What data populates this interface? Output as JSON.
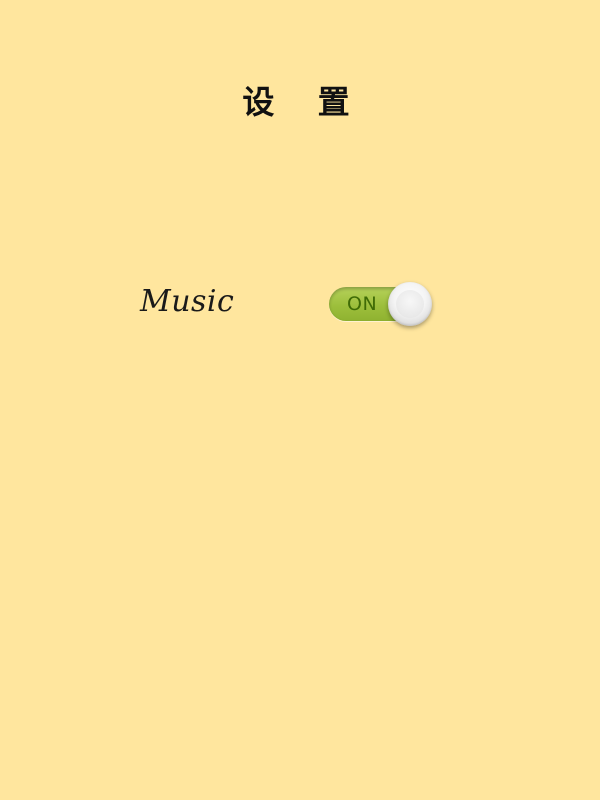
{
  "header": {
    "title": "设 置"
  },
  "settings": [
    {
      "label": "Music",
      "state_label": "ON",
      "enabled": true
    }
  ],
  "colors": {
    "background": "#FFE69E",
    "toggle_on": "#9dbf3c",
    "toggle_text": "#3f6b06"
  }
}
